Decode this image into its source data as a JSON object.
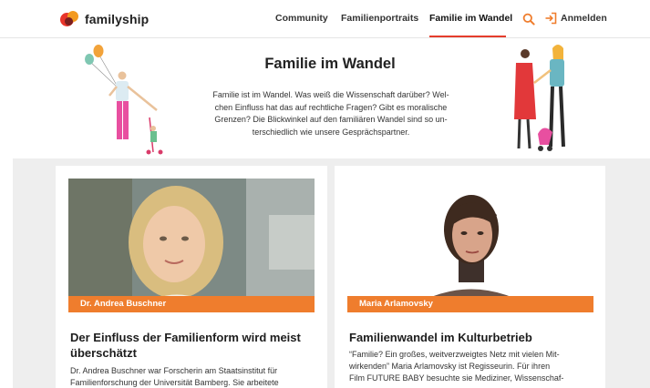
{
  "header": {
    "logo_text": "familyship",
    "nav": [
      "Community",
      "Familienportraits",
      "Familie im Wandel"
    ],
    "active_nav": "Familie im Wandel",
    "login_label": "Anmelden",
    "accent_color": "#e53d2c",
    "icons": [
      "search-icon",
      "login-icon"
    ]
  },
  "hero": {
    "title": "Familie im Wandel",
    "text_lines": [
      "Familie ist im Wandel. Was weiß die Wissenschaft darüber? Wel-",
      "chen Einfluss hat das auf rechtliche Fragen? Gibt es moralische",
      "Grenzen? Die Blickwinkel auf den familiären Wandel sind so un-",
      "terschiedlich wie unsere Gesprächspartner."
    ]
  },
  "cards": [
    {
      "person": "Dr. Andrea Buschner",
      "title_lines": [
        "Der Einfluss der Familienform wird meist",
        "überschätzt"
      ],
      "text_lines": [
        "Dr. Andrea Buschner war Forscherin am Staatsinstitut für",
        "Familienforschung der Universität Bamberg. Sie arbeitete"
      ]
    },
    {
      "person": "Maria Arlamovsky",
      "title_lines": [
        "Familienwandel im Kulturbetrieb"
      ],
      "text_lines": [
        "“Familie? Ein großes, weitverzweigtes Netz mit vielen Mit-",
        "wirkenden” Maria Arlamovsky ist Regisseurin. Für ihren",
        "Film FUTURE BABY besuchte sie Mediziner, Wissenschaf-"
      ]
    }
  ],
  "colors": {
    "label_orange": "#ef7d2d",
    "section_gray": "#eeeeee"
  }
}
